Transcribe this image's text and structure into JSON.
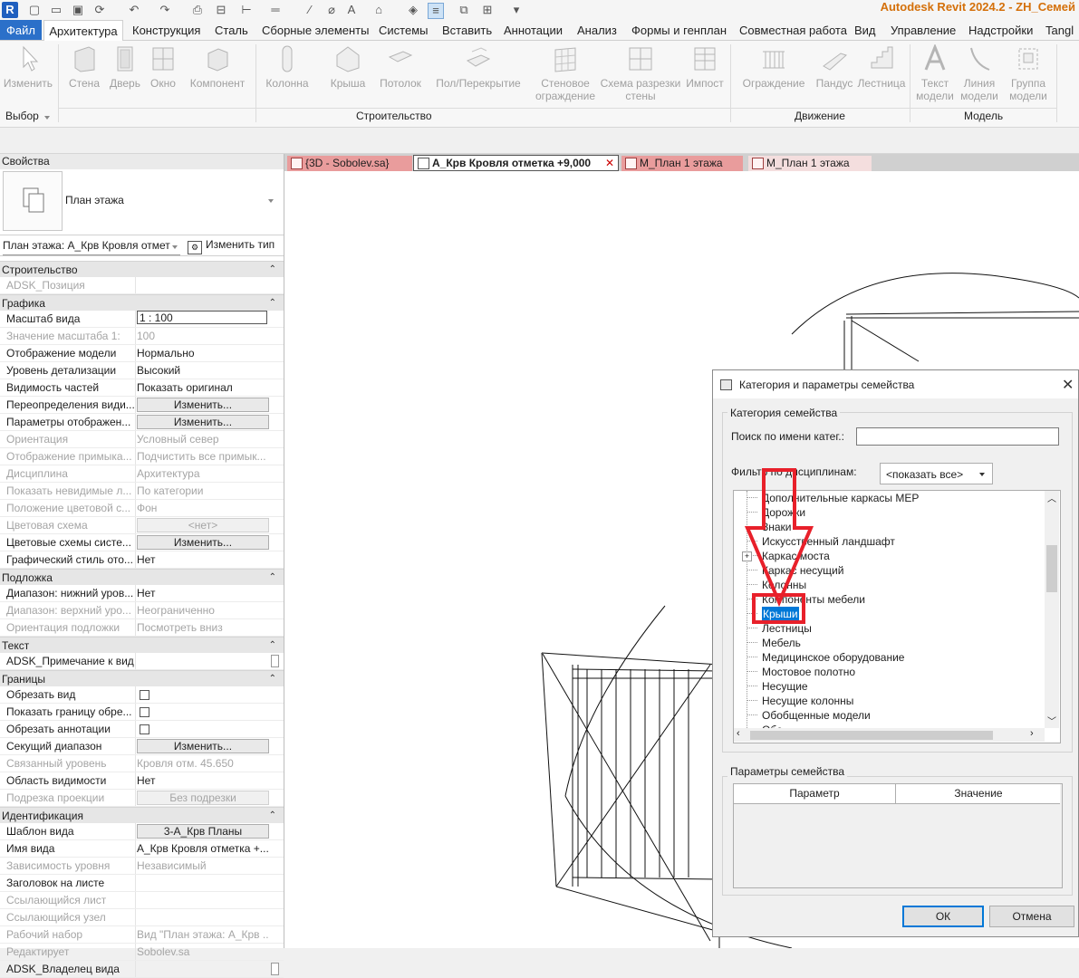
{
  "app": {
    "logo_letter": "R",
    "title": "Autodesk Revit 2024.2 - ZH_Семей"
  },
  "ribbon_tabs": [
    "Файл",
    "Архитектура",
    "Конструкция",
    "Сталь",
    "Сборные элементы",
    "Системы",
    "Вставить",
    "Аннотации",
    "Анализ",
    "Формы и генплан",
    "Совместная работа",
    "Вид",
    "Управление",
    "Надстройки",
    "Tangl"
  ],
  "ribbon": {
    "buttons": [
      "Изменить",
      "Стена",
      "Дверь",
      "Окно",
      "Компонент",
      "Колонна",
      "Крыша",
      "Потолок",
      "Пол/Перекрытие",
      "Стеновое ограждение",
      "Схема разрезки стены",
      "Импост",
      "Ограждение",
      "Пандус",
      "Лестница",
      "Текст модели",
      "Линия модели",
      "Группа модели"
    ],
    "panels": {
      "select": "Выбор",
      "build": "Строительство",
      "circulation": "Движение",
      "model": "Модель"
    }
  },
  "properties": {
    "title": "Свойства",
    "type_name": "План этажа",
    "instance_selector": "План этажа: А_Крв Кровля отмет",
    "edit_type": "Изменить тип",
    "groups": [
      {
        "name": "Строительство",
        "rows": [
          {
            "k": "ADSK_Позиция",
            "v": "",
            "dis": true
          }
        ]
      },
      {
        "name": "Графика",
        "rows": [
          {
            "k": "Масштаб вида",
            "v": "1 : 100",
            "kind": "input"
          },
          {
            "k": "Значение масштаба    1:",
            "v": "100",
            "dis": true
          },
          {
            "k": "Отображение модели",
            "v": "Нормально"
          },
          {
            "k": "Уровень детализации",
            "v": "Высокий"
          },
          {
            "k": "Видимость частей",
            "v": "Показать оригинал"
          },
          {
            "k": "Переопределения види...",
            "v": "Изменить...",
            "kind": "button"
          },
          {
            "k": "Параметры отображен...",
            "v": "Изменить...",
            "kind": "button"
          },
          {
            "k": "Ориентация",
            "v": "Условный север",
            "dis": true
          },
          {
            "k": "Отображение примыка...",
            "v": "Подчистить все примык...",
            "dis": true
          },
          {
            "k": "Дисциплина",
            "v": "Архитектура",
            "dis": true
          },
          {
            "k": "Показать невидимые л...",
            "v": "По категории",
            "dis": true
          },
          {
            "k": "Положение цветовой с...",
            "v": "Фон",
            "dis": true
          },
          {
            "k": "Цветовая схема",
            "v": "<нет>",
            "kind": "button",
            "dis": true
          },
          {
            "k": "Цветовые схемы систе...",
            "v": "Изменить...",
            "kind": "button"
          },
          {
            "k": "Графический стиль ото...",
            "v": "Нет"
          }
        ]
      },
      {
        "name": "Подложка",
        "rows": [
          {
            "k": "Диапазон: нижний уров...",
            "v": "Нет"
          },
          {
            "k": "Диапазон: верхний уро...",
            "v": "Неограниченно",
            "dis": true
          },
          {
            "k": "Ориентация подложки",
            "v": "Посмотреть вниз",
            "dis": true
          }
        ]
      },
      {
        "name": "Текст",
        "rows": [
          {
            "k": "ADSK_Примечание к виду",
            "v": "",
            "kind": "edit"
          }
        ]
      },
      {
        "name": "Границы",
        "rows": [
          {
            "k": "Обрезать вид",
            "v": "",
            "kind": "check"
          },
          {
            "k": "Показать границу обре...",
            "v": "",
            "kind": "check"
          },
          {
            "k": "Обрезать аннотации",
            "v": "",
            "kind": "check"
          },
          {
            "k": "Секущий диапазон",
            "v": "Изменить...",
            "kind": "button"
          },
          {
            "k": "Связанный уровень",
            "v": "Кровля отм. 45.650",
            "dis": true
          },
          {
            "k": "Область видимости",
            "v": "Нет"
          },
          {
            "k": "Подрезка проекции",
            "v": "Без подрезки",
            "kind": "button",
            "dis": true
          }
        ]
      },
      {
        "name": "Идентификация",
        "rows": [
          {
            "k": "Шаблон вида",
            "v": "3-А_Крв Планы",
            "kind": "button"
          },
          {
            "k": "Имя вида",
            "v": "А_Крв Кровля отметка +..."
          },
          {
            "k": "Зависимость уровня",
            "v": "Независимый",
            "dis": true
          },
          {
            "k": "Заголовок на листе",
            "v": ""
          },
          {
            "k": "Ссылающийся лист",
            "v": "",
            "dis": true
          },
          {
            "k": "Ссылающийся узел",
            "v": "",
            "dis": true
          },
          {
            "k": "Рабочий набор",
            "v": "Вид \"План этажа: А_Крв ...",
            "dis": true
          },
          {
            "k": "Редактирует",
            "v": "Sobolev.sa",
            "dis": true
          },
          {
            "k": "ADSK_Владелец вида",
            "v": "",
            "kind": "edit"
          }
        ]
      }
    ]
  },
  "view_tabs": [
    "{3D - Sobolev.sa}",
    "А_Крв Кровля отметка +9,000",
    "М_План 1 этажа",
    "М_План 1 этажа"
  ],
  "dialog": {
    "title": "Категория и параметры семейства",
    "category_group": "Категория семейства",
    "search_label": "Поиск по имени катег.:",
    "search_value": "",
    "filter_label": "Фильтр по дисциплинам:",
    "filter_value": "<показать все>",
    "categories": [
      "Дополнительные каркасы МЕР",
      "Дорожки",
      "Знаки",
      "Искусственный ландшафт",
      "Каркас моста",
      "Каркас несущий",
      "Колонны",
      "Компоненты мебели",
      "Крыши",
      "Лестницы",
      "Мебель",
      "Медицинское оборудование",
      "Мостовое полотно",
      "Несущие",
      "Несущие колонны",
      "Обобщенные модели",
      "Обо..."
    ],
    "selected_category": "Крыши",
    "params_group": "Параметры семейства",
    "params_columns": [
      "Параметр",
      "Значение"
    ],
    "ok": "ОК",
    "cancel": "Отмена"
  },
  "colors": {
    "annotation_red": "#e8202a",
    "selection_blue": "#0078d7",
    "title_orange": "#d4700a"
  }
}
